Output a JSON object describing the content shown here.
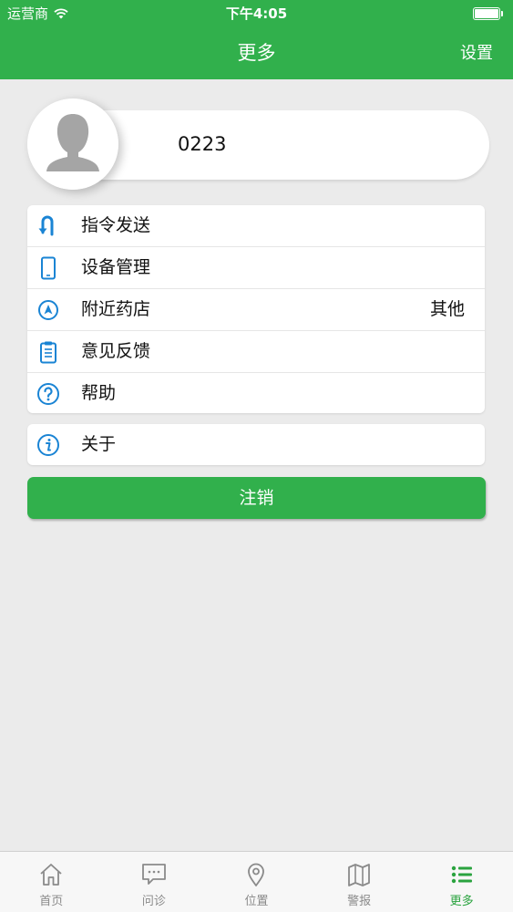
{
  "status_bar": {
    "carrier": "运营商",
    "time": "下午4:05"
  },
  "nav": {
    "title": "更多",
    "right_button": "设置"
  },
  "profile": {
    "name": "0223",
    "avatar_icon": "default-avatar-icon"
  },
  "menu": {
    "items": [
      {
        "label": "指令发送",
        "icon": "command-send-icon"
      },
      {
        "label": "设备管理",
        "icon": "phone-device-icon"
      },
      {
        "label": "附近药店",
        "icon": "location-arrow-icon",
        "extra": "其他"
      },
      {
        "label": "意见反馈",
        "icon": "clipboard-icon"
      },
      {
        "label": "帮助",
        "icon": "help-question-icon"
      }
    ],
    "about": {
      "label": "关于",
      "icon": "info-icon"
    }
  },
  "logout_button": "注销",
  "tabbar": {
    "tabs": [
      {
        "label": "首页",
        "icon": "home-icon",
        "active": false
      },
      {
        "label": "问诊",
        "icon": "chat-bubble-icon",
        "active": false
      },
      {
        "label": "位置",
        "icon": "location-pin-icon",
        "active": false
      },
      {
        "label": "警报",
        "icon": "map-icon",
        "active": false
      },
      {
        "label": "更多",
        "icon": "list-icon",
        "active": true
      }
    ]
  },
  "colors": {
    "brand_green": "#31b04c",
    "icon_blue": "#1a84d4",
    "background": "#ebebeb",
    "tab_inactive": "#8a8a8a"
  }
}
